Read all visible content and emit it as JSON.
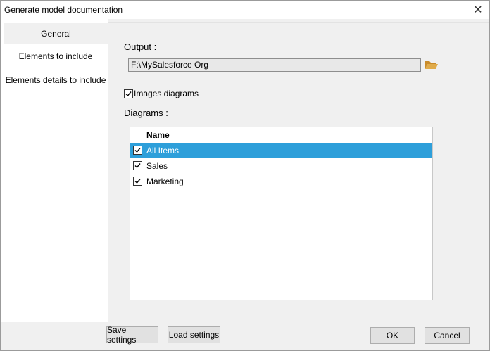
{
  "window": {
    "title": "Generate model documentation",
    "close_glyph": "✕"
  },
  "tabs": [
    {
      "label": "General"
    },
    {
      "label": "Elements to include"
    },
    {
      "label": "Elements details to include"
    }
  ],
  "general": {
    "output_label": "Output :",
    "output_value": "F:\\MySalesforce Org",
    "images_checkbox_label": "Images diagrams",
    "images_checked": true,
    "diagrams_label": "Diagrams :",
    "grid": {
      "header": "Name",
      "rows": [
        {
          "label": "All Items",
          "checked": true,
          "selected": true
        },
        {
          "label": "Sales",
          "checked": true,
          "selected": false
        },
        {
          "label": "Marketing",
          "checked": true,
          "selected": false
        }
      ]
    }
  },
  "footer": {
    "save_label": "Save settings",
    "load_label": "Load settings",
    "ok_label": "OK",
    "cancel_label": "Cancel"
  },
  "colors": {
    "selection": "#2e9fda",
    "folder": "#d9a441"
  },
  "icons": {
    "browse": "folder-icon",
    "check": "check-icon"
  }
}
